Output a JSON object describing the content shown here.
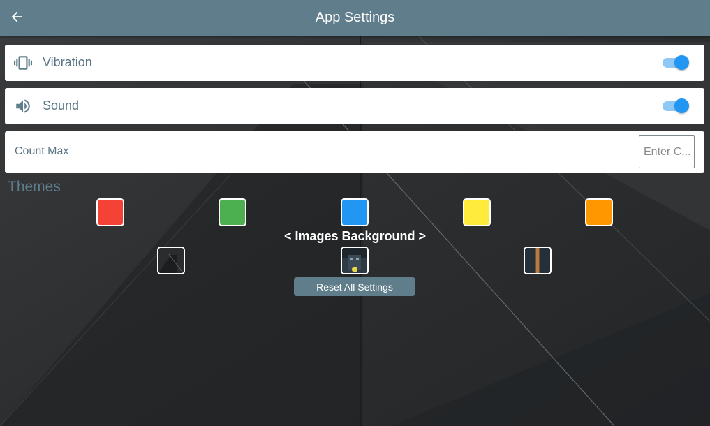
{
  "header": {
    "title": "App Settings",
    "back_icon": "arrow-left-icon"
  },
  "settings": {
    "vibration": {
      "label": "Vibration",
      "icon": "vibration-icon",
      "enabled": true
    },
    "sound": {
      "label": "Sound",
      "icon": "volume-icon",
      "enabled": true
    },
    "count_max": {
      "label": "Count Max",
      "placeholder": "Enter C...",
      "value": ""
    }
  },
  "themes": {
    "label": "Themes",
    "colors": [
      {
        "name": "red",
        "hex": "#f44336"
      },
      {
        "name": "green",
        "hex": "#4caf50"
      },
      {
        "name": "blue",
        "hex": "#2196f3"
      },
      {
        "name": "yellow",
        "hex": "#ffeb3b"
      },
      {
        "name": "orange",
        "hex": "#ff9800"
      }
    ]
  },
  "images_background": {
    "heading": "< Images Background >",
    "images": [
      "dark-concrete",
      "night-street-lamp",
      "wooden-guitar"
    ]
  },
  "actions": {
    "reset_label": "Reset All Settings"
  },
  "colors": {
    "primary": "#5f7d8a",
    "accent": "#2196f3",
    "accent_light": "#90c8f5",
    "card": "#ffffff",
    "label_text": "#5a7583"
  }
}
